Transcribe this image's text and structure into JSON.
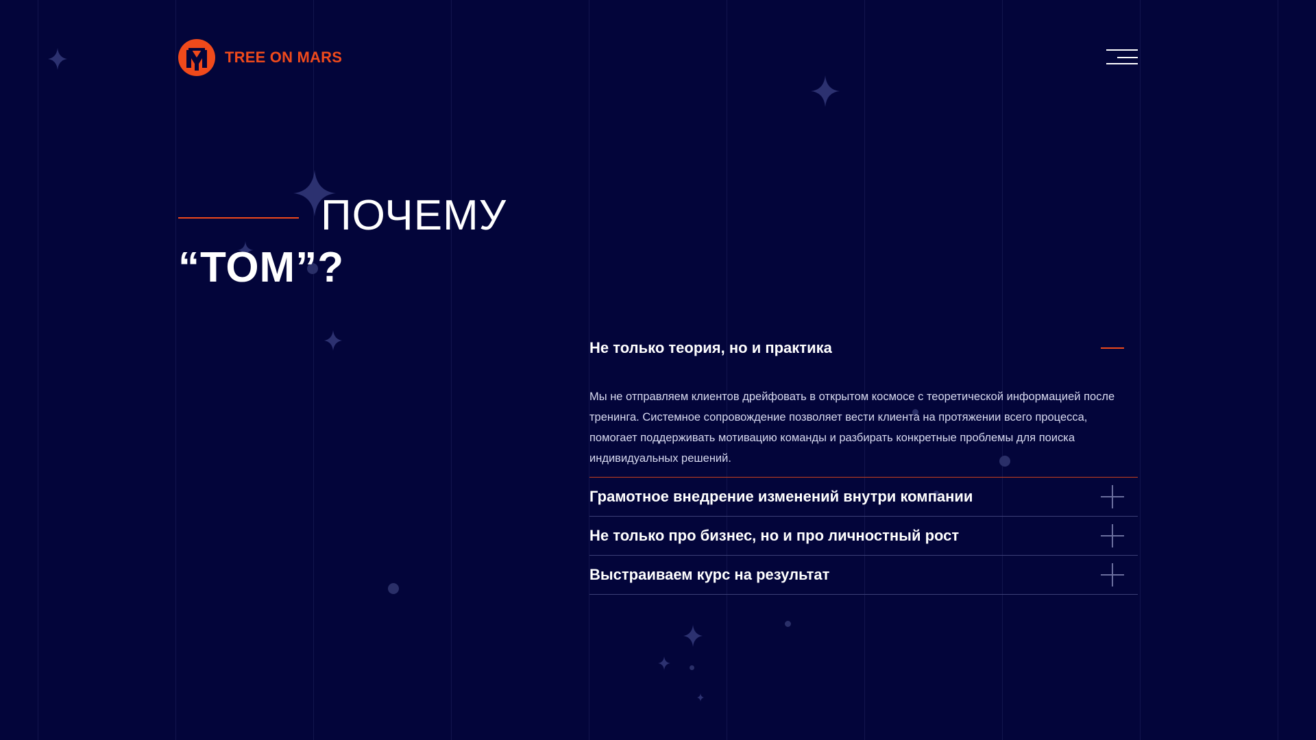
{
  "header": {
    "logo_text": "TREE ON MARS",
    "menu_icon": "hamburger-menu-icon"
  },
  "title": {
    "line1": "ПОЧЕМУ",
    "line2": "“ТОМ”?"
  },
  "accordion": {
    "items": [
      {
        "title": "Не только теория, но и практика",
        "body": "Мы не отправляем клиентов дрейфовать в открытом космосе с теоретической информацией после тренинга. Системное сопровождение позволяет вести клиента на протяжении всего процесса, помогает поддерживать мотивацию команды и разбирать конкретные проблемы для поиска индивидуальных решений.",
        "expanded": true,
        "icon": "minus-icon"
      },
      {
        "title": "Грамотное внедрение изменений внутри компании",
        "expanded": false,
        "icon": "plus-icon"
      },
      {
        "title": "Не только про бизнес, но и про личностный рост",
        "expanded": false,
        "icon": "plus-icon"
      },
      {
        "title": "Выстраиваем курс на результат",
        "expanded": false,
        "icon": "plus-icon"
      }
    ]
  },
  "colors": {
    "background": "#03053a",
    "accent": "#f04a1b",
    "text": "#ffffff",
    "divider": "#3c4078"
  }
}
